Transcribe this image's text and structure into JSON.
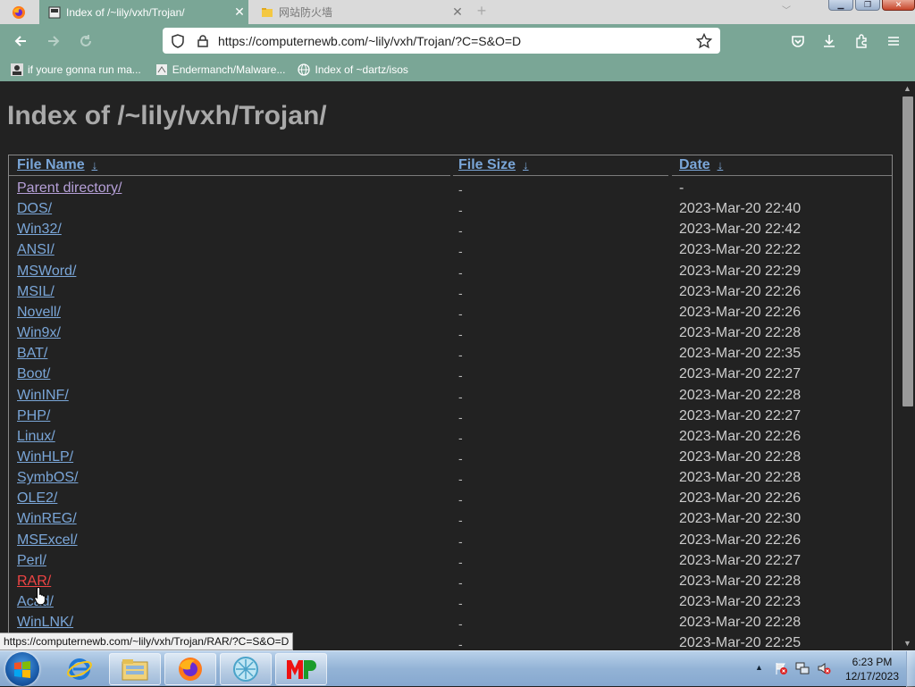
{
  "browser": {
    "tabs": [
      {
        "title": "Index of /~lily/vxh/Trojan/",
        "active": true
      },
      {
        "title": "网站防火墙",
        "active": false
      }
    ],
    "url": "https://computernewb.com/~lily/vxh/Trojan/?C=S&O=D",
    "bookmarks": [
      {
        "label": "if youre gonna run ma...",
        "icon": "user-icon"
      },
      {
        "label": "Endermanch/Malware...",
        "icon": "page-icon"
      },
      {
        "label": "Index of ~dartz/isos",
        "icon": "globe-icon"
      }
    ],
    "status_url": "https://computernewb.com/~lily/vxh/Trojan/RAR/?C=S&O=D"
  },
  "page": {
    "heading": "Index of /~lily/vxh/Trojan/",
    "columns": {
      "name": "File Name",
      "size": "File Size",
      "date": "Date",
      "sort_arrow": "↓"
    },
    "rows": [
      {
        "name": "Parent directory/",
        "size": "-",
        "date": "-"
      },
      {
        "name": "DOS/",
        "size": "-",
        "date": "2023-Mar-20 22:40"
      },
      {
        "name": "Win32/",
        "size": "-",
        "date": "2023-Mar-20 22:42"
      },
      {
        "name": "ANSI/",
        "size": "-",
        "date": "2023-Mar-20 22:22"
      },
      {
        "name": "MSWord/",
        "size": "-",
        "date": "2023-Mar-20 22:29"
      },
      {
        "name": "MSIL/",
        "size": "-",
        "date": "2023-Mar-20 22:26"
      },
      {
        "name": "Novell/",
        "size": "-",
        "date": "2023-Mar-20 22:26"
      },
      {
        "name": "Win9x/",
        "size": "-",
        "date": "2023-Mar-20 22:28"
      },
      {
        "name": "BAT/",
        "size": "-",
        "date": "2023-Mar-20 22:35"
      },
      {
        "name": "Boot/",
        "size": "-",
        "date": "2023-Mar-20 22:27"
      },
      {
        "name": "WinINF/",
        "size": "-",
        "date": "2023-Mar-20 22:28"
      },
      {
        "name": "PHP/",
        "size": "-",
        "date": "2023-Mar-20 22:27"
      },
      {
        "name": "Linux/",
        "size": "-",
        "date": "2023-Mar-20 22:26"
      },
      {
        "name": "WinHLP/",
        "size": "-",
        "date": "2023-Mar-20 22:28"
      },
      {
        "name": "SymbOS/",
        "size": "-",
        "date": "2023-Mar-20 22:28"
      },
      {
        "name": "OLE2/",
        "size": "-",
        "date": "2023-Mar-20 22:26"
      },
      {
        "name": "WinREG/",
        "size": "-",
        "date": "2023-Mar-20 22:30"
      },
      {
        "name": "MSExcel/",
        "size": "-",
        "date": "2023-Mar-20 22:26"
      },
      {
        "name": "Perl/",
        "size": "-",
        "date": "2023-Mar-20 22:27"
      },
      {
        "name": "RAR/",
        "size": "-",
        "date": "2023-Mar-20 22:28"
      },
      {
        "name": "Acad/",
        "size": "-",
        "date": "2023-Mar-20 22:23"
      },
      {
        "name": "WinLNK/",
        "size": "-",
        "date": "2023-Mar-20 22:28"
      },
      {
        "name": "",
        "size": "-",
        "date": "2023-Mar-20 22:25"
      }
    ]
  },
  "taskbar": {
    "apps": [
      "explorer-icon",
      "internet-explorer-icon",
      "folder-icon",
      "firefox-icon",
      "crystal-app-icon",
      "mp-app-icon"
    ],
    "time": "6:23 PM",
    "date": "12/17/2023"
  },
  "colors": {
    "accent": "#7aa696",
    "link": "#7aa6d8",
    "hover_link": "#e44444",
    "page_bg": "#222222"
  }
}
